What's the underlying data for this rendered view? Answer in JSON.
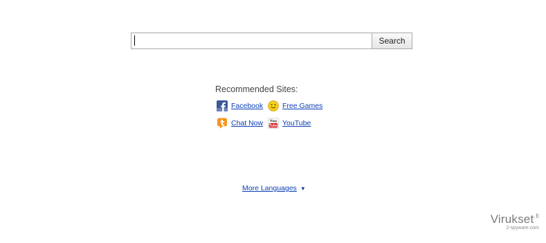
{
  "search": {
    "value": "",
    "button_label": "Search"
  },
  "recommended": {
    "title": "Recommended Sites:",
    "sites": [
      {
        "label": "Facebook",
        "icon": "facebook-icon",
        "color": "#3b5998"
      },
      {
        "label": "Free Games",
        "icon": "smiley-icon",
        "color": "#f5c400"
      },
      {
        "label": "Chat Now",
        "icon": "chat-icon",
        "color": "#f7941d"
      },
      {
        "label": "YouTube",
        "icon": "youtube-icon",
        "color": "#cc181e"
      }
    ]
  },
  "more_languages": {
    "label": "More Languages",
    "arrow": "▼"
  },
  "watermark": {
    "main": "Virukset",
    "tld": ".fi",
    "sub": "2-spyware.com"
  },
  "colors": {
    "link": "#0b3fb5",
    "border": "#a9a9a9"
  }
}
